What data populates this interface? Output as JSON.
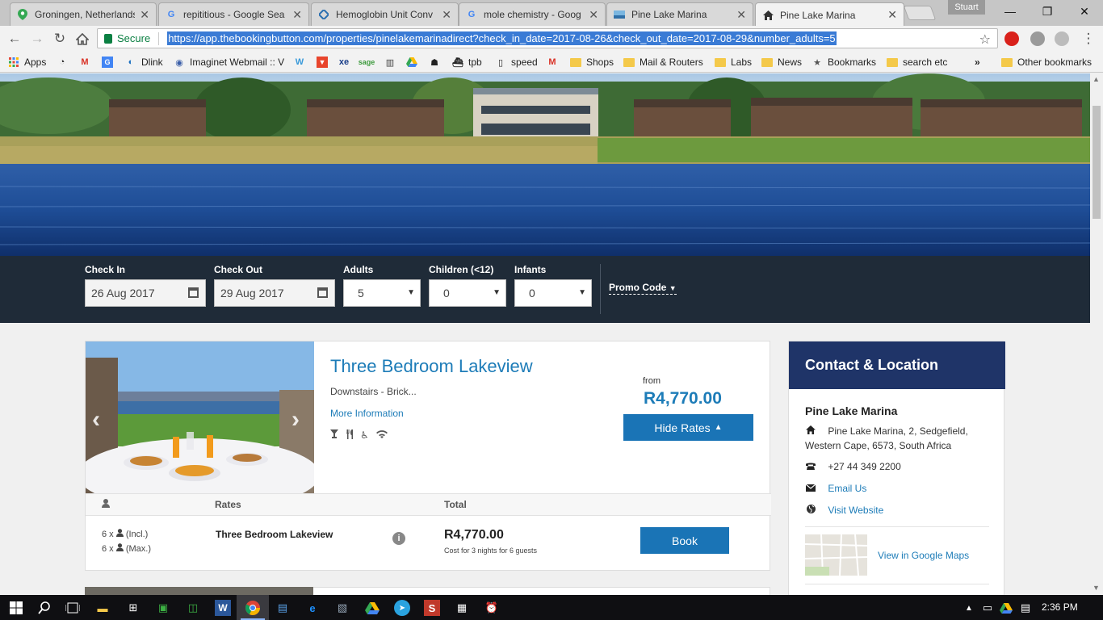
{
  "browser": {
    "tabs": [
      {
        "title": "Groningen, Netherlands",
        "icon": "google-maps-icon",
        "active": false
      },
      {
        "title": "repititious - Google Sea",
        "icon": "google-icon",
        "active": false
      },
      {
        "title": "Hemoglobin Unit Conv",
        "icon": "diamond-icon",
        "active": false
      },
      {
        "title": "mole chemistry - Goog",
        "icon": "google-icon",
        "active": false
      },
      {
        "title": "Pine Lake Marina",
        "icon": "site-icon",
        "active": false
      },
      {
        "title": "Pine Lake Marina",
        "icon": "home-icon",
        "active": true
      }
    ],
    "profile_name": "Stuart",
    "secure_label": "Secure",
    "url": "https://app.thebookingbutton.com/properties/pinelakemarinadirect?check_in_date=2017-08-26&check_out_date=2017-08-29&number_adults=5",
    "bookmarks": [
      {
        "label": "Apps",
        "icon": "apps-grid-icon"
      },
      {
        "label": "",
        "icon": "speedometer-icon"
      },
      {
        "label": "",
        "icon": "gmail-icon"
      },
      {
        "label": "",
        "icon": "translate-icon"
      },
      {
        "label": "Dlink",
        "icon": "dlink-icon"
      },
      {
        "label": "Imaginet Webmail :: V",
        "icon": "webmail-icon"
      },
      {
        "label": "",
        "icon": "wordpress-icon"
      },
      {
        "label": "",
        "icon": "shield-icon"
      },
      {
        "label": "",
        "icon": "xe-icon"
      },
      {
        "label": "",
        "icon": "sage-icon"
      },
      {
        "label": "",
        "icon": "library-icon"
      },
      {
        "label": "",
        "icon": "drive-icon"
      },
      {
        "label": "",
        "icon": "robot-icon"
      },
      {
        "label": "tpb",
        "icon": "pirate-ship-icon"
      },
      {
        "label": "speed",
        "icon": "page-icon"
      },
      {
        "label": "",
        "icon": "gmail-icon"
      },
      {
        "label": "Shops",
        "icon": "folder-icon"
      },
      {
        "label": "Mail & Routers",
        "icon": "folder-icon"
      },
      {
        "label": "Labs",
        "icon": "folder-icon"
      },
      {
        "label": "News",
        "icon": "folder-icon"
      },
      {
        "label": "Bookmarks",
        "icon": "star-icon"
      },
      {
        "label": "search etc",
        "icon": "folder-icon"
      }
    ],
    "overflow_label": "»",
    "other_bookmarks": "Other bookmarks"
  },
  "search": {
    "check_in_label": "Check In",
    "check_in_value": "26 Aug 2017",
    "check_out_label": "Check Out",
    "check_out_value": "29 Aug 2017",
    "adults_label": "Adults",
    "adults_value": "5",
    "children_label": "Children (<12)",
    "children_value": "0",
    "infants_label": "Infants",
    "infants_value": "0",
    "promo_label": "Promo Code"
  },
  "room": {
    "title": "Three Bedroom Lakeview",
    "description": "Downstairs - Brick...",
    "more_info": "More Information",
    "amenities": [
      "cocktail-icon",
      "restaurant-icon",
      "wheelchair-icon",
      "wifi-icon"
    ],
    "from_label": "from",
    "price": "R4,770.00",
    "hide_rates_label": "Hide Rates"
  },
  "rates": {
    "col_rates": "Rates",
    "col_total": "Total",
    "occupancy_incl": "6 x",
    "occupancy_incl_suffix": "(Incl.)",
    "occupancy_max": "6 x",
    "occupancy_max_suffix": "(Max.)",
    "rate_name": "Three Bedroom Lakeview",
    "total": "R4,770.00",
    "total_note": "Cost for 3 nights for 6 guests",
    "book_label": "Book"
  },
  "contact": {
    "heading": "Contact & Location",
    "name": "Pine Lake Marina",
    "address_line1": "Pine Lake Marina, 2, Sedgefield,",
    "address_line2": "Western Cape, 6573, South Africa",
    "phone": "+27 44 349 2200",
    "email_label": "Email Us",
    "website_label": "Visit Website",
    "maps_label": "View in Google Maps"
  },
  "taskbar": {
    "clock": "2:36 PM"
  },
  "colors": {
    "accent": "#1a74b6",
    "link": "#1d7cb8",
    "search_bg": "#1f2b38",
    "contact_header": "#1f3468"
  }
}
